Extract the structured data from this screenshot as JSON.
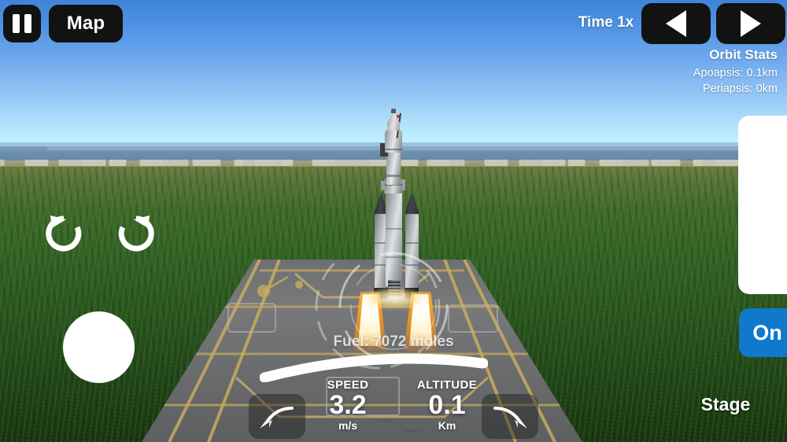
{
  "topbar": {
    "pause_icon": "pause-icon",
    "map_label": "Map",
    "time_label": "Time 1x",
    "time_down_icon": "triangle-left-icon",
    "time_up_icon": "triangle-right-icon"
  },
  "orbit_stats": {
    "title": "Orbit Stats",
    "apoapsis": "Apoapsis: 0.1km",
    "periapsis": "Periapsis: 0km"
  },
  "right_controls": {
    "throttle_name": "throttle-slider",
    "engine_toggle_label": "On",
    "stage_label": "Stage"
  },
  "left_controls": {
    "rotate_ccw_icon": "rotate-counterclockwise-icon",
    "rotate_cw_icon": "rotate-clockwise-icon",
    "joystick_name": "translation-joystick"
  },
  "hud": {
    "fuel_readout": "Fuel: 7072 moles",
    "pitch_left_icon": "curved-arrow-left-icon",
    "pitch_right_icon": "curved-arrow-right-icon",
    "telemetry": [
      {
        "label": "SPEED",
        "value": "3.2",
        "unit": "m/s"
      },
      {
        "label": "ALTITUDE",
        "value": "0.1",
        "unit": "Km"
      }
    ]
  },
  "colors": {
    "button_black": "#121212",
    "engine_on_blue": "#1179cb",
    "hud_white": "#ffffff",
    "sky_top": "#3f83da",
    "sky_horizon": "#c3f2fe",
    "ocean": "#6d8fae",
    "grass": "#27531f",
    "pad_concrete": "#6d6f70",
    "pad_marking": "#c9ac5e",
    "flame_core": "#ffffff",
    "flame_edge": "#ff9614"
  }
}
